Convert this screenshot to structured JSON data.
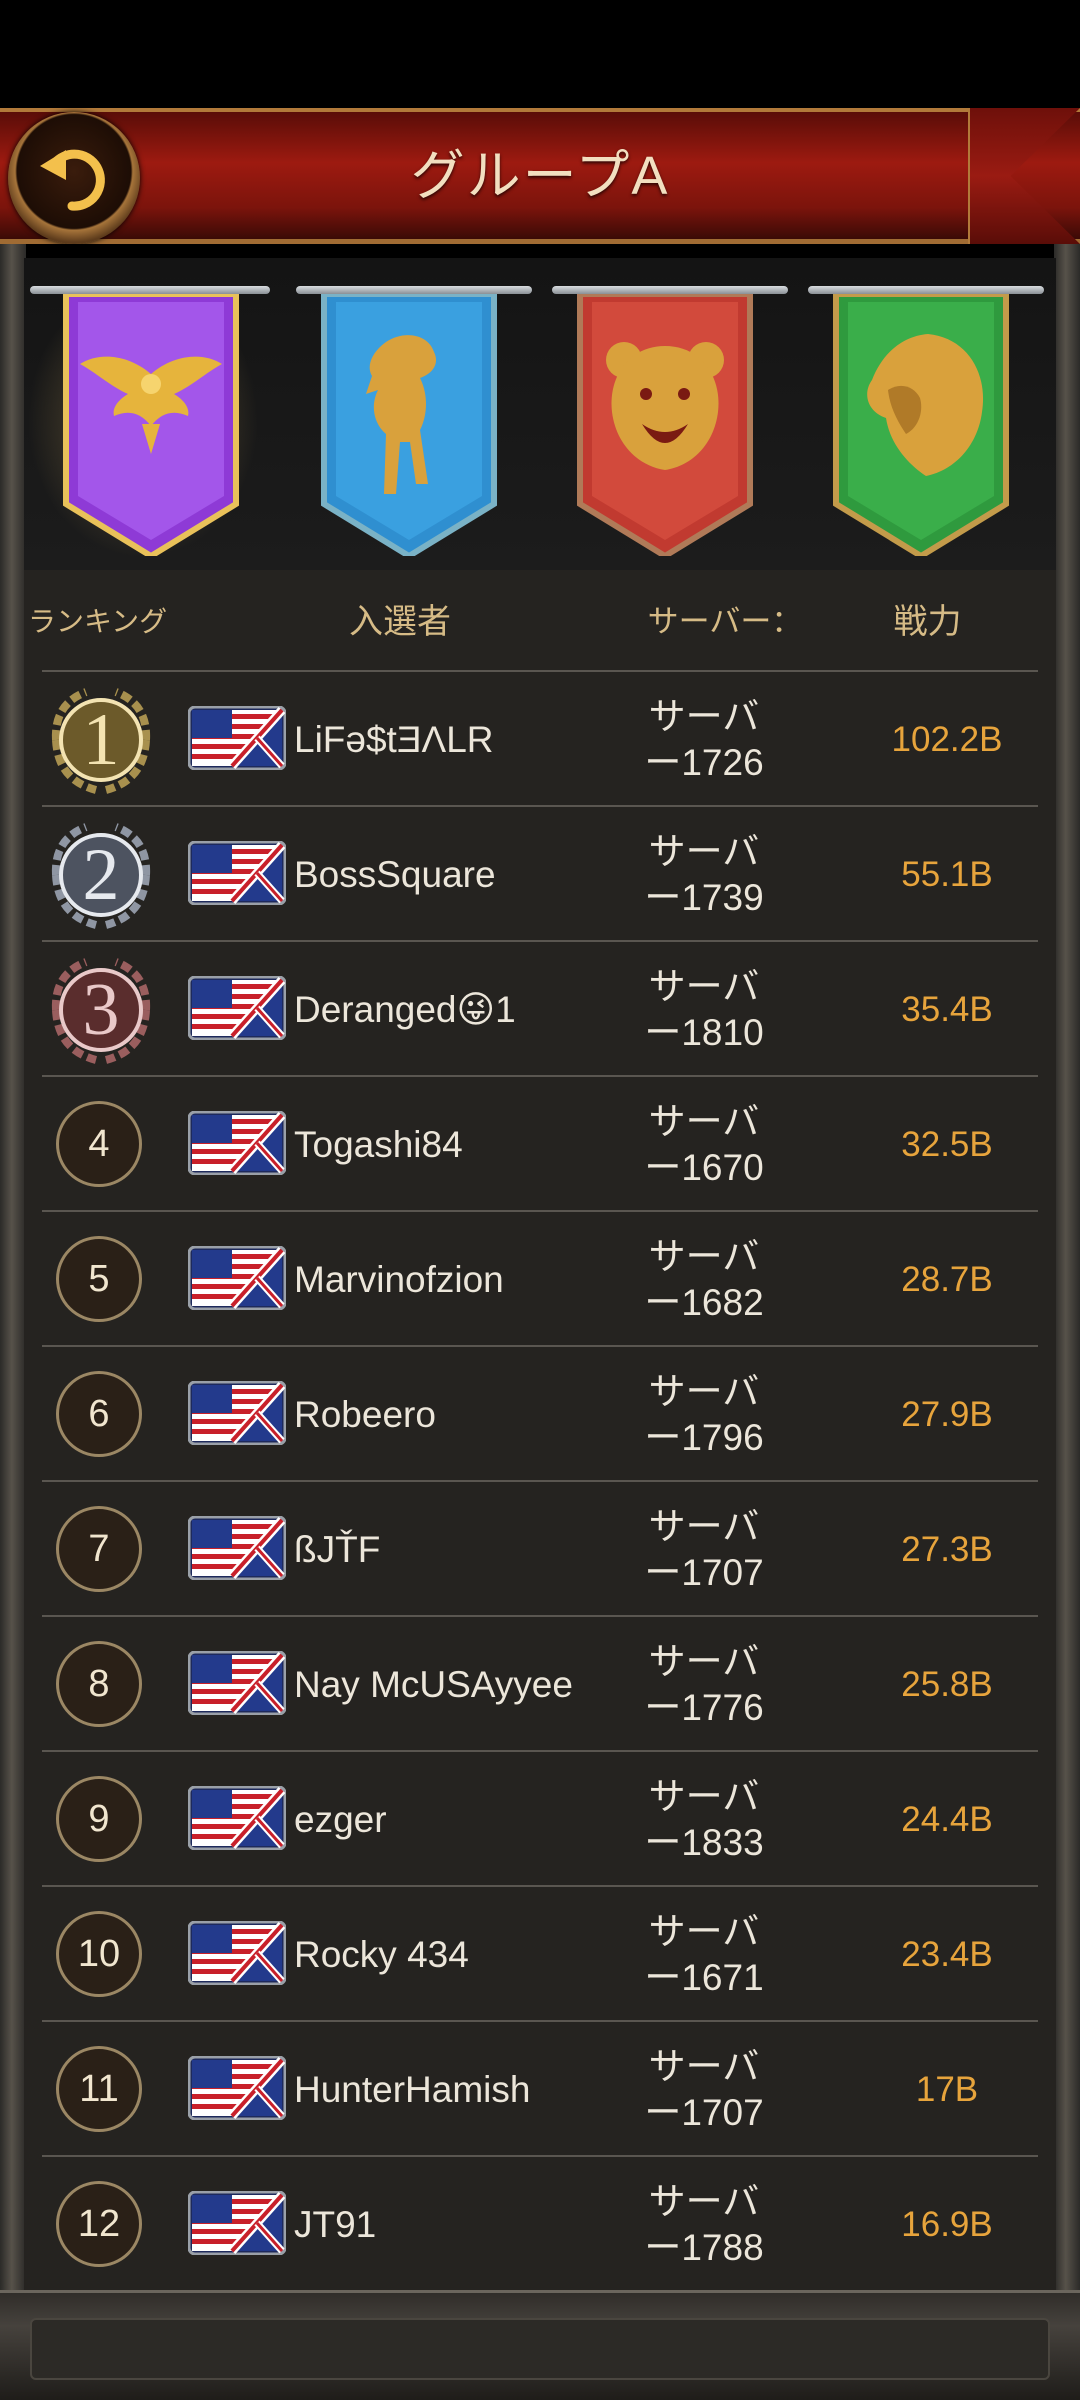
{
  "header": {
    "title": "グループA"
  },
  "banners": [
    {
      "emblem": "eagle-icon",
      "color": "#8e3ad6",
      "selected": true
    },
    {
      "emblem": "horse-icon",
      "color": "#2f8fd0",
      "selected": false
    },
    {
      "emblem": "bear-icon",
      "color": "#c13a30",
      "selected": false
    },
    {
      "emblem": "lion-icon",
      "color": "#2f9a3e",
      "selected": false
    }
  ],
  "columns": {
    "rank": "ランキング",
    "player": "入選者",
    "server": "サーバー：",
    "power": "戦力"
  },
  "rows": [
    {
      "rank": "1",
      "name": "LiFə$tƎΛLR",
      "server_top": "サーバ",
      "server_bottom": "ー1726",
      "power": "102.2B"
    },
    {
      "rank": "2",
      "name": "BossSquare",
      "server_top": "サーバ",
      "server_bottom": "ー1739",
      "power": "55.1B"
    },
    {
      "rank": "3",
      "name": "Deranged😜1",
      "server_top": "サーバ",
      "server_bottom": "ー1810",
      "power": "35.4B"
    },
    {
      "rank": "4",
      "name": "Togashi84",
      "server_top": "サーバ",
      "server_bottom": "ー1670",
      "power": "32.5B"
    },
    {
      "rank": "5",
      "name": "Marvinofzion",
      "server_top": "サーバ",
      "server_bottom": "ー1682",
      "power": "28.7B"
    },
    {
      "rank": "6",
      "name": "Robeero",
      "server_top": "サーバ",
      "server_bottom": "ー1796",
      "power": "27.9B"
    },
    {
      "rank": "7",
      "name": "ßJŤF",
      "server_top": "サーバ",
      "server_bottom": "ー1707",
      "power": "27.3B"
    },
    {
      "rank": "8",
      "name": "Nay McUSAyyee",
      "server_top": "サーバ",
      "server_bottom": "ー1776",
      "power": "25.8B"
    },
    {
      "rank": "9",
      "name": "ezger",
      "server_top": "サーバ",
      "server_bottom": "ー1833",
      "power": "24.4B"
    },
    {
      "rank": "10",
      "name": "Rocky 434",
      "server_top": "サーバ",
      "server_bottom": "ー1671",
      "power": "23.4B"
    },
    {
      "rank": "11",
      "name": "HunterHamish",
      "server_top": "サーバ",
      "server_bottom": "ー1707",
      "power": "17B"
    },
    {
      "rank": "12",
      "name": "JT91",
      "server_top": "サーバ",
      "server_bottom": "ー1788",
      "power": "16.9B"
    }
  ],
  "icons": {
    "back": "back-arrow-icon",
    "flag": "us-uk-flag-icon",
    "medals": [
      "gold-medal-icon",
      "silver-medal-icon",
      "bronze-medal-icon"
    ]
  }
}
